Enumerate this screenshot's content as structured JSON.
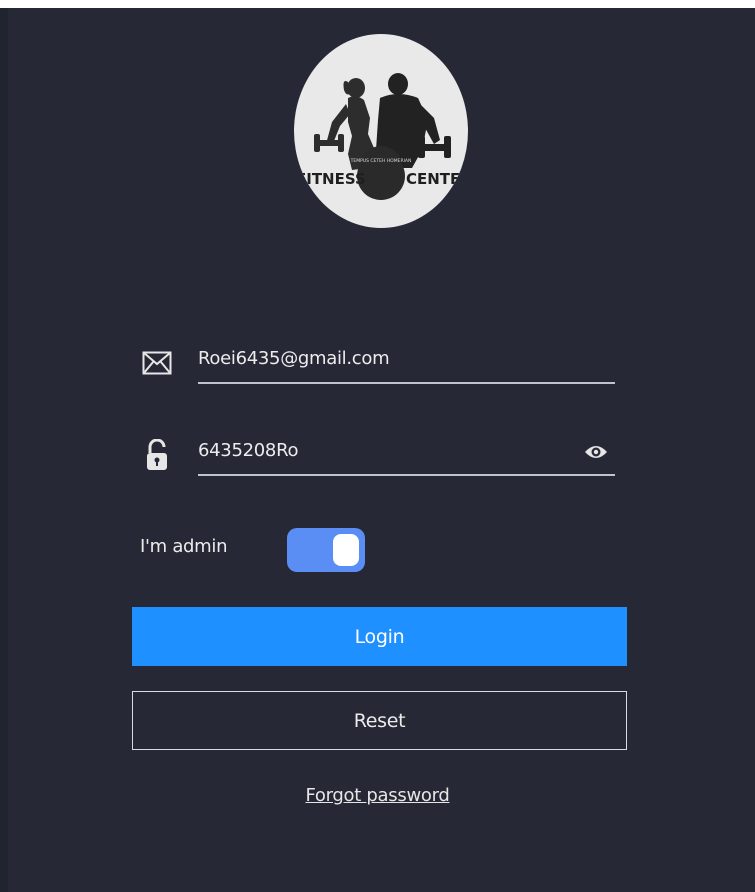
{
  "logo": {
    "name": "fitness-center-logo",
    "text_left": "FITNESS",
    "text_right": "CENTER",
    "text_arc": "TEMPUS CETEH HOMERIAN"
  },
  "login_form": {
    "email": {
      "value": "Roei6435@gmail.com",
      "icon": "envelope-icon"
    },
    "password": {
      "value": "6435208Ro",
      "icon": "unlocked-padlock-icon",
      "toggle_icon": "eye-icon"
    },
    "admin": {
      "label": "I'm admin",
      "checked": true
    },
    "login_label": "Login",
    "reset_label": "Reset",
    "forgot_label": "Forgot password"
  },
  "colors": {
    "background": "#262935",
    "accent": "#1e90ff",
    "toggle_on": "#5b8ef5",
    "text": "#ececec"
  }
}
